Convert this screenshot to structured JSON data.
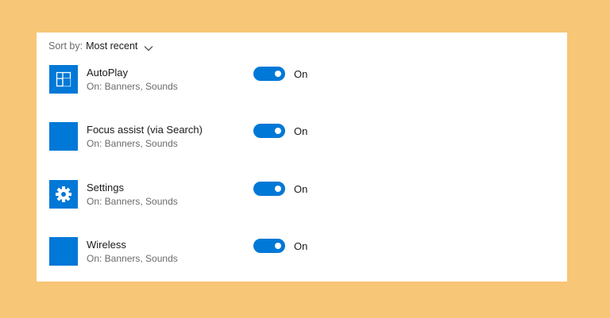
{
  "sort": {
    "label": "Sort by:",
    "value": "Most recent"
  },
  "apps": [
    {
      "name": "AutoPlay",
      "subtitle": "On: Banners, Sounds",
      "toggle_state": "On",
      "icon": "autoplay-icon"
    },
    {
      "name": "Focus assist (via Search)",
      "subtitle": "On: Banners, Sounds",
      "toggle_state": "On",
      "icon": "blank-app-icon"
    },
    {
      "name": "Settings",
      "subtitle": "On: Banners, Sounds",
      "toggle_state": "On",
      "icon": "gear-icon"
    },
    {
      "name": "Wireless",
      "subtitle": "On: Banners, Sounds",
      "toggle_state": "On",
      "icon": "blank-app-icon"
    }
  ],
  "colors": {
    "accent": "#0078d7",
    "background": "#f8c677",
    "panel": "#ffffff"
  }
}
